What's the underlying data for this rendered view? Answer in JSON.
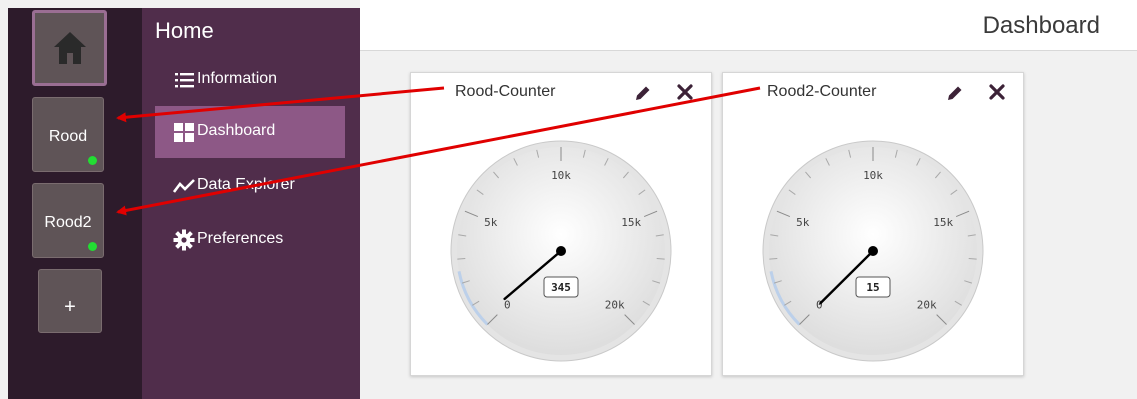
{
  "header": {
    "title": "Dashboard"
  },
  "rail": {
    "devices": [
      {
        "label": "Rood",
        "status_color": "#22dd33"
      },
      {
        "label": "Rood2",
        "status_color": "#22dd33"
      }
    ],
    "add_label": "+"
  },
  "menu": {
    "title": "Home",
    "items": [
      {
        "label": "Information",
        "icon": "list-icon"
      },
      {
        "label": "Dashboard",
        "icon": "dashboard-icon",
        "active": true
      },
      {
        "label": "Data Explorer",
        "icon": "chart-line-icon"
      },
      {
        "label": "Preferences",
        "icon": "gear-icon"
      }
    ]
  },
  "widgets": [
    {
      "title": "Rood-Counter",
      "value": 345,
      "display": "345",
      "ticks": [
        "0",
        "5k",
        "10k",
        "15k",
        "20k"
      ]
    },
    {
      "title": "Rood2-Counter",
      "value": 15,
      "display": "15",
      "ticks": [
        "0",
        "5k",
        "10k",
        "15k",
        "20k"
      ]
    }
  ],
  "colors": {
    "accent": "#8d5886",
    "annotation_arrow": "#e00000"
  }
}
